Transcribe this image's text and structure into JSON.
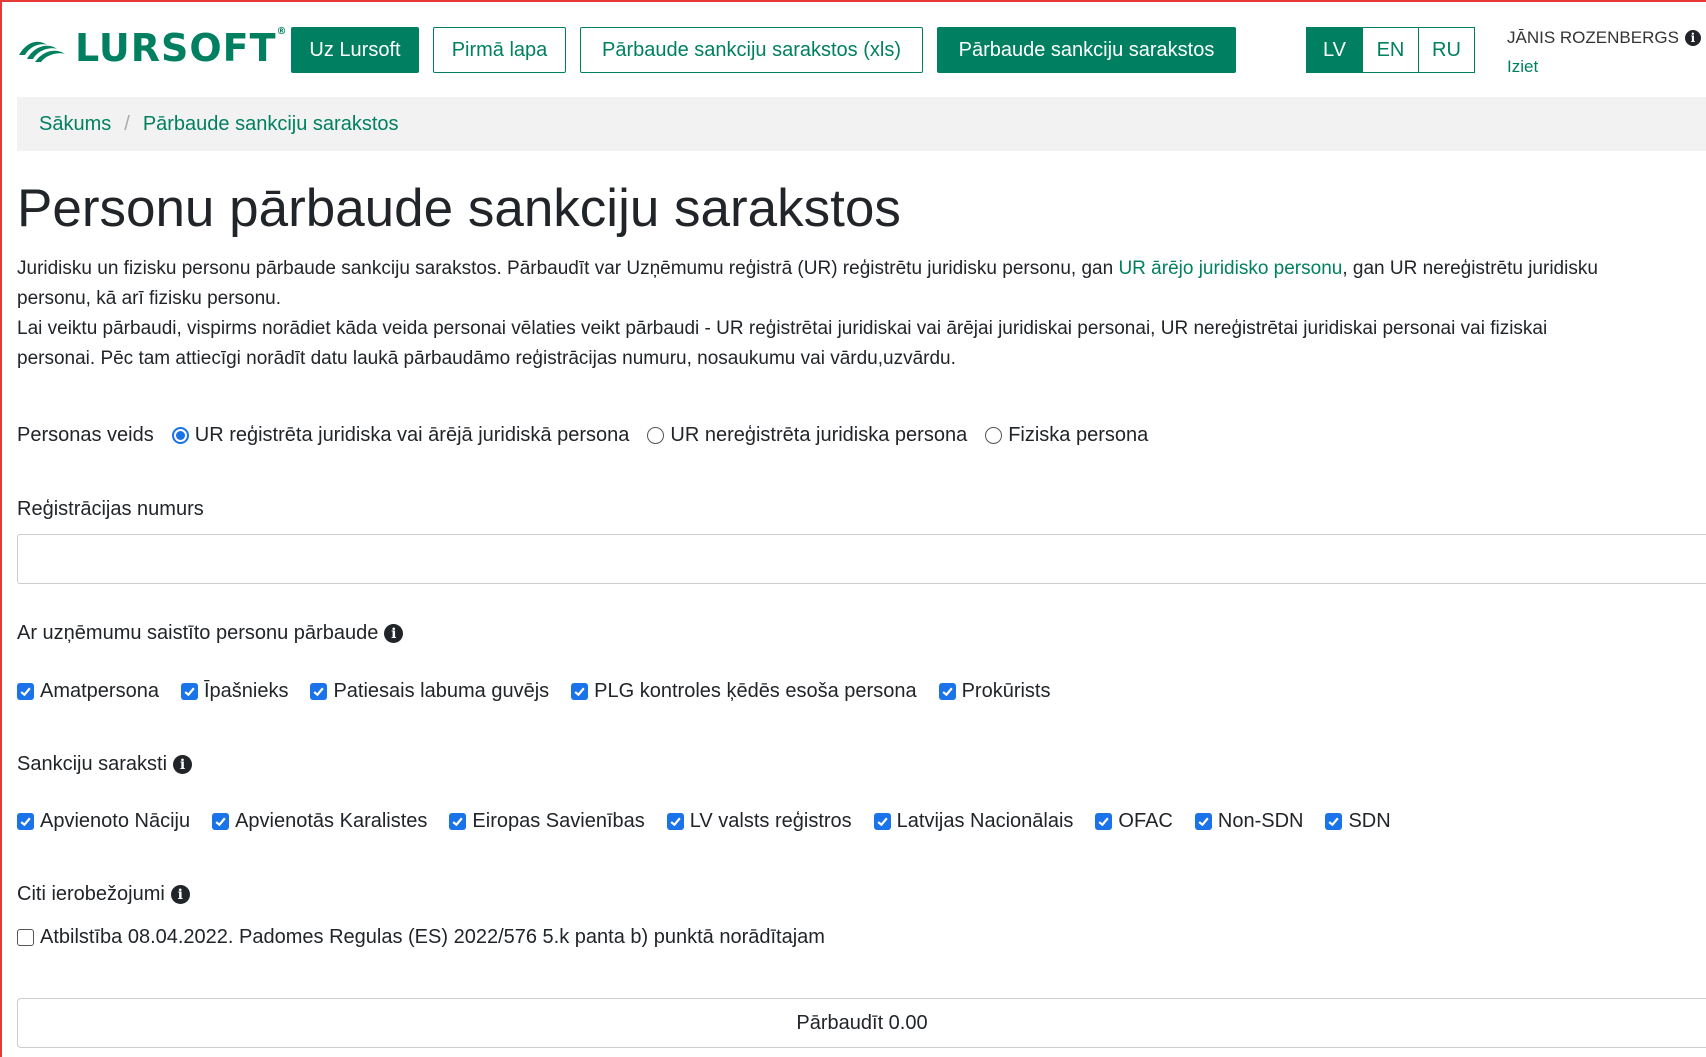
{
  "header": {
    "logo_text": "LURSOFT",
    "logo_reg": "®",
    "nav": {
      "about": "Uz Lursoft",
      "home": "Pirmā lapa",
      "check_xls": "Pārbaude sankciju sarakstos (xls)",
      "check": "Pārbaude sankciju sarakstos"
    },
    "languages": [
      "LV",
      "EN",
      "RU"
    ],
    "active_language": "LV",
    "user_name": "JĀNIS ROZENBERGS",
    "logout": "Iziet"
  },
  "breadcrumb": {
    "home": "Sākums",
    "separator": "/",
    "current": "Pārbaude sankciju sarakstos"
  },
  "page_title": "Personu pārbaude sankciju sarakstos",
  "intro": {
    "p1_before": "Juridisku un fizisku personu pārbaude sankciju sarakstos. Pārbaudīt var Uzņēmumu reģistrā (UR) reģistrētu juridisku personu, gan ",
    "p1_link": "UR ārējo juridisko personu",
    "p1_after": ", gan UR nereģistrētu juridisku personu, kā arī fizisku personu.",
    "p2": "Lai veiktu pārbaudi, vispirms norādiet kāda veida personai vēlaties veikt pārbaudi - UR reģistrētai juridiskai vai ārējai juridiskai personai, UR nereģistrētai juridiskai personai vai fiziskai personai. Pēc tam attiecīgi norādīt datu laukā pārbaudāmo reģistrācijas numuru, nosaukumu vai vārdu,uzvārdu."
  },
  "person_type": {
    "label": "Personas veids",
    "options": [
      {
        "label": "UR reģistrēta juridiska vai ārējā juridiskā persona",
        "checked": true
      },
      {
        "label": "UR nereģistrēta juridiska persona",
        "checked": false
      },
      {
        "label": "Fiziska persona",
        "checked": false
      }
    ]
  },
  "reg_number": {
    "label": "Reģistrācijas numurs",
    "value": ""
  },
  "related_persons": {
    "label": "Ar uzņēmumu saistīto personu pārbaude",
    "items": [
      {
        "label": "Amatpersona",
        "checked": true
      },
      {
        "label": "Īpašnieks",
        "checked": true
      },
      {
        "label": "Patiesais labuma guvējs",
        "checked": true
      },
      {
        "label": "PLG kontroles ķēdēs esoša persona",
        "checked": true
      },
      {
        "label": "Prokūrists",
        "checked": true
      }
    ]
  },
  "sanction_lists": {
    "label": "Sankciju saraksti",
    "items": [
      {
        "label": "Apvienoto Nāciju",
        "checked": true
      },
      {
        "label": "Apvienotās Karalistes",
        "checked": true
      },
      {
        "label": "Eiropas Savienības",
        "checked": true
      },
      {
        "label": "LV valsts reģistros",
        "checked": true
      },
      {
        "label": "Latvijas Nacionālais",
        "checked": true
      },
      {
        "label": "OFAC",
        "checked": true
      },
      {
        "label": "Non-SDN",
        "checked": true
      },
      {
        "label": "SDN",
        "checked": true
      }
    ]
  },
  "other_restrictions": {
    "label": "Citi ierobežojumi",
    "item": {
      "label": "Atbilstība 08.04.2022. Padomes Regulas (ES) 2022/576 5.k panta b) punktā norādītajam",
      "checked": false
    }
  },
  "submit_label": "Pārbaudīt 0.00",
  "colors": {
    "brand": "#008060",
    "checkbox": "#1a73e8",
    "frame": "#e53935"
  }
}
